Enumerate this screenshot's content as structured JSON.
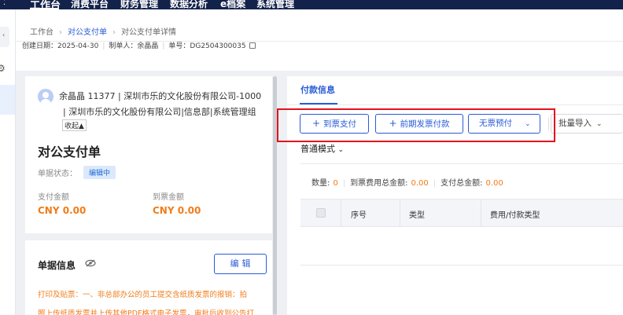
{
  "topnav": {
    "items": [
      "工作台",
      "消费平台",
      "财务管理",
      "数据分析",
      "e档案",
      "系统管理"
    ]
  },
  "breadcrumb": [
    "工作台",
    "对公支付单",
    "对公支付单详情"
  ],
  "meta": {
    "created": "创建日期：2025-04-30",
    "creator": "制单人：余晶晶",
    "doc_no": "单号：DG2504300035"
  },
  "left": {
    "user_line1": "余晶晶 11377 | 深圳市乐的文化股份有限公司-1000",
    "user_line2": "| 深圳市乐的文化股份有限公司|信息部|系统管理组",
    "collapse": "收起▲",
    "title": "对公支付单",
    "status_label": "单据状态：",
    "status_value": "编辑中",
    "pay_label": "支付金额",
    "pay_value": "CNY 0.00",
    "invoice_label": "到票金额",
    "invoice_value": "CNY 0.00",
    "section_title": "单据信息",
    "edit_label": "编辑",
    "note_line1": "打印及贴票：一、非总部办公的员工提交含纸质发票的报销：拍",
    "note_line2": "照上传纸质发票并上传其他PDF格式电子发票，审批后收到公告打"
  },
  "right": {
    "tab": "付款信息",
    "buttons": {
      "arrival_pay": "到票支付",
      "prior_invoice": "前期发票付款",
      "no_invoice": "无票预付",
      "batch_import": "批量导入"
    },
    "mode": "普通模式",
    "summary": {
      "count_label": "数量:",
      "count_value": "0",
      "fee_label": "到票费用总金额:",
      "fee_value": "0.00",
      "pay_label": "支付总金额:",
      "pay_value": "0.00"
    },
    "columns": [
      "序号",
      "类型",
      "费用/付款类型"
    ]
  },
  "colors": {
    "nav_bg": "#13224b",
    "primary": "#2a5bd7",
    "amount": "#f07c1a",
    "highlight_box": "#e3121c"
  }
}
